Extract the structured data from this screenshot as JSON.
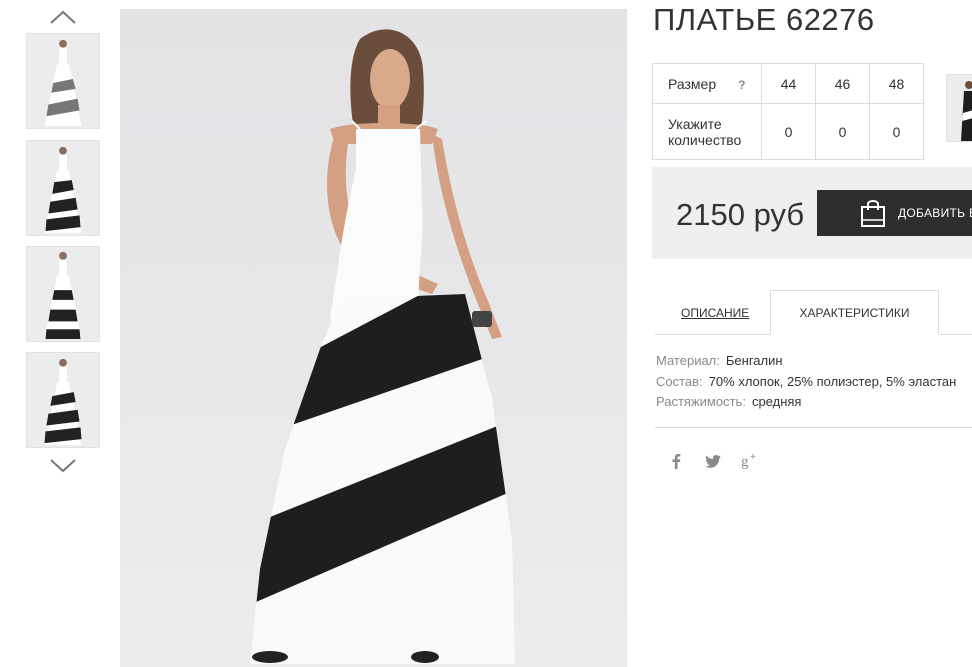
{
  "product": {
    "title": "ПЛАТЬЕ 62276",
    "price": "2150 руб"
  },
  "size_table": {
    "size_label": "Размер",
    "help": "?",
    "sizes": [
      "44",
      "46",
      "48"
    ],
    "qty_label_line1": "Укажите",
    "qty_label_line2": "количество",
    "quantities": [
      "0",
      "0",
      "0"
    ]
  },
  "cart": {
    "button_label": "ДОБАВИТЬ В"
  },
  "tabs": [
    {
      "label": "ОПИСАНИЕ",
      "active": false
    },
    {
      "label": "ХАРАКТЕРИСТИКИ",
      "active": true
    }
  ],
  "specs": [
    {
      "key": "Материал:",
      "value": "Бенгалин"
    },
    {
      "key": "Состав:",
      "value": "70% хлопок, 25% полиэстер, 5% эластан"
    },
    {
      "key": "Растяжимость:",
      "value": "средняя"
    }
  ],
  "share": [
    "facebook-icon",
    "twitter-icon",
    "google-plus-icon"
  ],
  "colors": {
    "button_bg": "#2e2e2e",
    "price_box_bg": "#efefef",
    "photo_bg": "#e4e4e6"
  }
}
